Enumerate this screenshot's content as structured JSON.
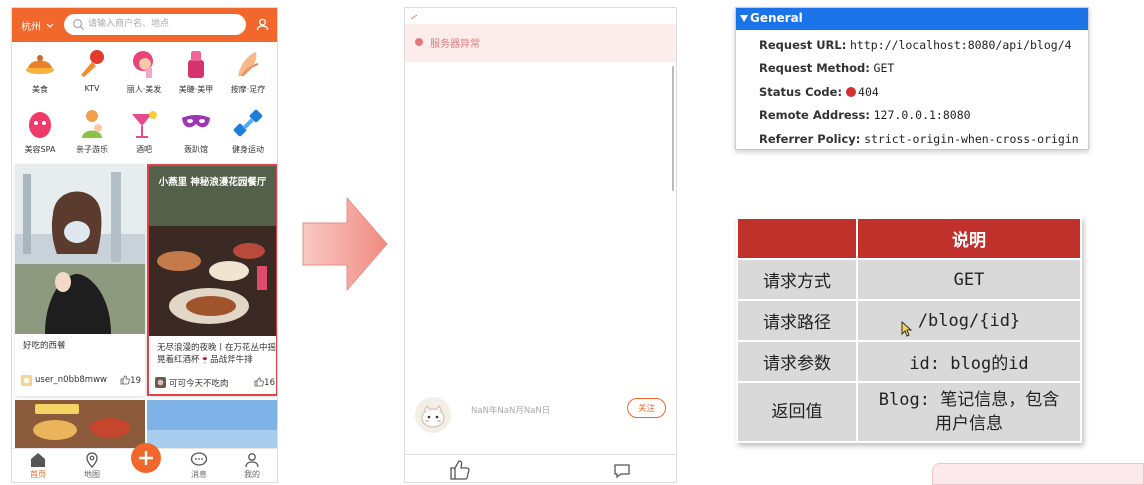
{
  "phone1": {
    "city": "杭州",
    "search_placeholder": "请输入商户名、地点",
    "categories": [
      {
        "label": "美食",
        "icon": "food-icon"
      },
      {
        "label": "KTV",
        "icon": "microphone-icon"
      },
      {
        "label": "丽人·美发",
        "icon": "hair-icon"
      },
      {
        "label": "美睫·美甲",
        "icon": "nail-icon"
      },
      {
        "label": "按摩·足疗",
        "icon": "massage-icon"
      },
      {
        "label": "美容SPA",
        "icon": "spa-icon"
      },
      {
        "label": "亲子游乐",
        "icon": "family-icon"
      },
      {
        "label": "酒吧",
        "icon": "cocktail-icon"
      },
      {
        "label": "轰趴馆",
        "icon": "party-mask-icon"
      },
      {
        "label": "健身运动",
        "icon": "dumbbell-icon"
      }
    ],
    "cards": [
      {
        "title": "好吃的西餐",
        "user": "user_n0bb8mww",
        "likes": "19"
      },
      {
        "title": "无尽浪漫的夜晚丨在万花丛中摇晃着红酒杯🍷品战斧牛排",
        "user": "可可今天不吃肉",
        "likes": "16",
        "image_caption": "小燕里 神秘浪漫花园餐厅"
      }
    ],
    "tabs": [
      "首页",
      "地图",
      "",
      "消息",
      "我的"
    ]
  },
  "phone2": {
    "error_text": "服务器异常",
    "date": "NaN年NaN月NaN日",
    "follow_label": "关注"
  },
  "devtools": {
    "section": "General",
    "rows": [
      {
        "key": "Request URL:",
        "value": "http://localhost:8080/api/blog/4"
      },
      {
        "key": "Request Method:",
        "value": "GET"
      },
      {
        "key": "Status Code:",
        "value": "404"
      },
      {
        "key": "Remote Address:",
        "value": "127.0.0.1:8080"
      },
      {
        "key": "Referrer Policy:",
        "value": "strict-origin-when-cross-origin"
      }
    ]
  },
  "api_table": {
    "header": [
      "",
      "说明"
    ],
    "rows": [
      [
        "请求方式",
        "GET"
      ],
      [
        "请求路径",
        "/blog/{id}"
      ],
      [
        "请求参数",
        "id: blog的id"
      ],
      [
        "返回值",
        "Blog: 笔记信息，包含用户信息"
      ]
    ]
  },
  "colors": {
    "accent": "#f2682c",
    "table_header": "#c0312b",
    "devtools_header": "#1a73e8",
    "error_text": "#e07a7a"
  }
}
